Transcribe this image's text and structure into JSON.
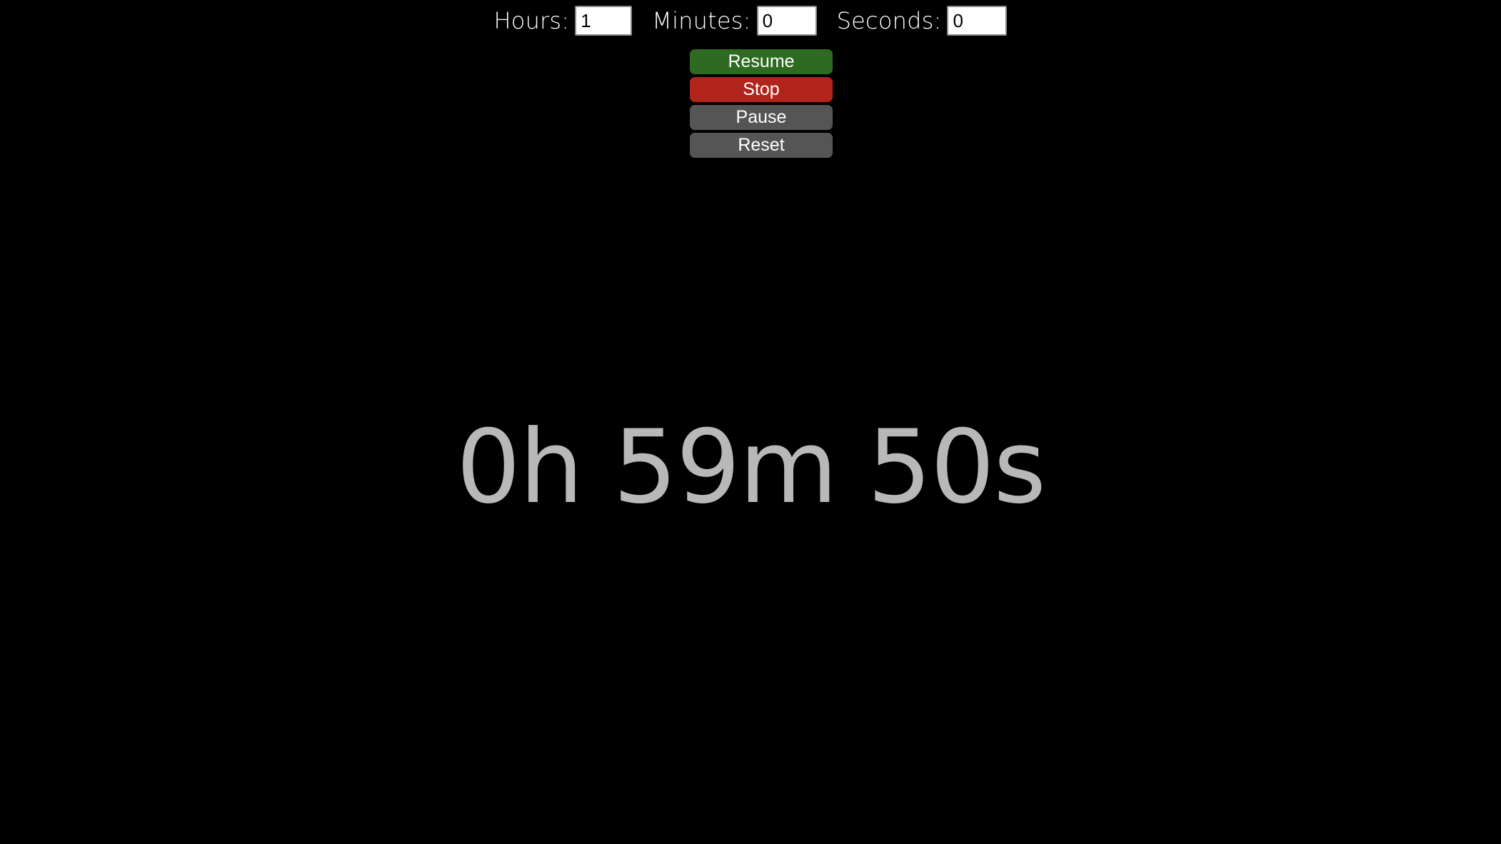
{
  "time_inputs": {
    "hours_label": "Hours:",
    "hours_value": "1",
    "minutes_label": "Minutes:",
    "minutes_value": "0",
    "seconds_label": "Seconds:",
    "seconds_value": "0"
  },
  "controls": {
    "resume_label": "Resume",
    "stop_label": "Stop",
    "pause_label": "Pause",
    "reset_label": "Reset"
  },
  "timer": {
    "display": "0h 59m 50s"
  },
  "colors": {
    "background": "#000000",
    "resume": "#2f6a22",
    "stop": "#b0241c",
    "neutral_button": "#555555",
    "timer_text": "#b8b8b8"
  }
}
